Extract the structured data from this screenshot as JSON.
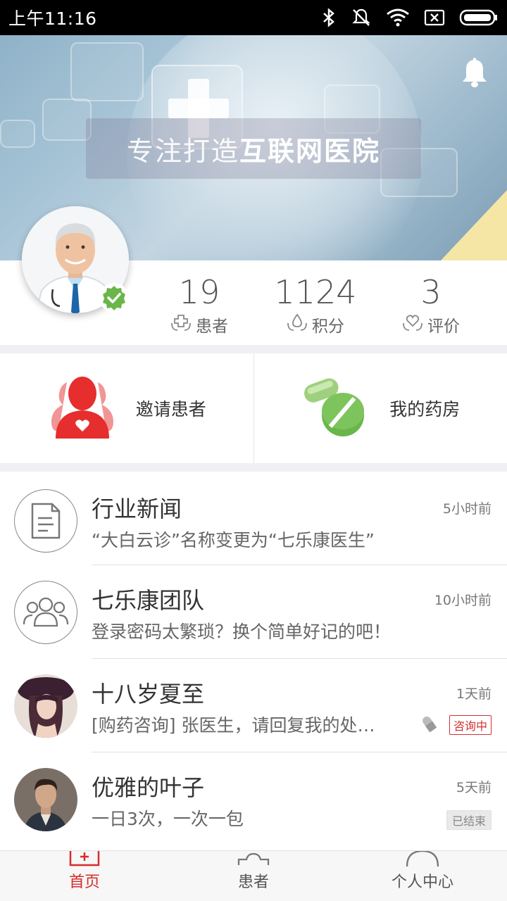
{
  "status_bar": {
    "time": "上午11:16",
    "icons": [
      "bluetooth-icon",
      "vibrate-off-icon",
      "wifi-icon",
      "sim-x-icon",
      "battery-icon"
    ]
  },
  "banner": {
    "slogan_light": "专注打造",
    "slogan_bold": "互联网医院",
    "icon": "bell-icon"
  },
  "doctor": {
    "verified_icon": "check-badge-icon"
  },
  "stats": [
    {
      "value": "19",
      "label": "患者",
      "icon": "cross-hands-icon"
    },
    {
      "value": "1124",
      "label": "积分",
      "icon": "drop-hands-icon"
    },
    {
      "value": "3",
      "label": "评价",
      "icon": "heart-hands-icon"
    }
  ],
  "actions": [
    {
      "label": "邀请患者",
      "icon": "invite-patient-icon"
    },
    {
      "label": "我的药房",
      "icon": "pharmacy-pills-icon"
    }
  ],
  "messages": [
    {
      "name": "行业新闻",
      "time": "5小时前",
      "message": "“大白云诊”名称变更为“七乐康医生”",
      "avatar": "news-doc-icon"
    },
    {
      "name": "七乐康团队",
      "time": "10小时前",
      "message": "登录密码太繁琐？换个简单好记的吧！",
      "avatar": "team-icon"
    },
    {
      "name": "十八岁夏至",
      "time": "1天前",
      "message": "[购药咨询] 张医生，请回复我的处…",
      "status": "咨询中",
      "status_icon": "pill-icon"
    },
    {
      "name": "优雅的叶子",
      "time": "5天前",
      "message": "一日3次，一次一包",
      "status": "已结束"
    }
  ],
  "bottom_nav": [
    {
      "label": "首页",
      "icon": "home-icon",
      "active": true
    },
    {
      "label": "患者",
      "icon": "patients-icon",
      "active": false
    },
    {
      "label": "个人中心",
      "icon": "profile-icon",
      "active": false
    }
  ],
  "colors": {
    "accent": "#d92b2b",
    "green": "#6ab64a",
    "banner_corner": "#f5e6a6"
  }
}
